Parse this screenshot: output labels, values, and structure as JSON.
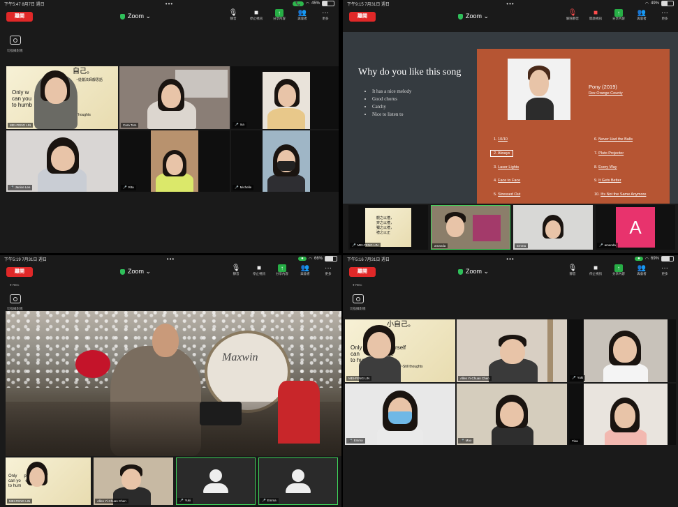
{
  "common": {
    "leave_label": "離開",
    "zoom_title": "Zoom ⌄",
    "more_dots": "•••",
    "camera_label": "切換攝影機",
    "rec_label": "● REC",
    "tool_labels": {
      "mute": "靜音",
      "stop_video": "停止視訊",
      "share": "分享內容",
      "participants": "與會者",
      "more": "更多"
    }
  },
  "q1": {
    "time": "下午5:47  8月7日 週日",
    "battery": "45%",
    "participant_count": "6",
    "slide_heading": "自己。",
    "slide_sub": "~從嚴法師靜思語",
    "slide_text": "Only w     pect yourself\ncan you      courage\nto humb",
    "slide_more": "Thoughts",
    "tiles": [
      "MEI-FENG LIN",
      "Cara Tom",
      "Ina",
      "Janice Lee",
      "Rita",
      "Michelle"
    ]
  },
  "q2": {
    "time": "下午9:15  7月31日 週日",
    "battery": "49%",
    "participant_count": "",
    "tool_labels": {
      "unmute": "解除靜音",
      "start_video": "開啟視訊",
      "share": "分享內容",
      "participants": "與會者",
      "more": "更多"
    },
    "slide_title": "Why do you like this song",
    "bullets": [
      "It has a nice melody",
      "Good chorus",
      "Catchy",
      "Nice to listen to"
    ],
    "album_title": "Pony (2019)",
    "album_artist": "Rex Orange County",
    "tracks_left": [
      [
        "1.",
        "10/10"
      ],
      [
        "2.",
        "Always"
      ],
      [
        "3.",
        "Laser Lights"
      ],
      [
        "4.",
        "Face to Face"
      ],
      [
        "5.",
        "Stressed Out"
      ]
    ],
    "tracks_right": [
      [
        "6.",
        "Never Had the Balls"
      ],
      [
        "7.",
        "Pluto Projector"
      ],
      [
        "8.",
        "Every Way"
      ],
      [
        "9.",
        "It Gets Better"
      ],
      [
        "10.",
        "It's Not the Same Anymore"
      ]
    ],
    "strip": [
      "MEI-FENG LIN",
      "amanda",
      "Emma",
      "amanda"
    ],
    "avatar_letter": "A",
    "strip_slide": "觀之以禮，\n齊之以禮，\n獨之以禮，\n禮之以正"
  },
  "q3": {
    "time": "下午5:19  7月31日 週日",
    "battery": "66%",
    "drum_text": "Maxwin",
    "strip": [
      "MEI-FENG LIN",
      "Allen Yi-Chuan Chen",
      "Yuki",
      "Emma"
    ],
    "strip_slide": "Only      pect yourself\ncan yo    e courage\nto hum"
  },
  "q4": {
    "time": "下午5:16  7月31日 週日",
    "battery": "69%",
    "participant_count": "5",
    "tiles": [
      "MEI-FENG LIN",
      "Allen Yi-Chuan Chen",
      "Yuki",
      "Emma",
      "Mao",
      "Tina"
    ],
    "slide_heading": "小自己。",
    "slide_text": "Only      spect yourself\ncan         courage\nto hum",
    "slide_more": "~Still thoughts"
  },
  "colors": {
    "leave": "#e02828",
    "share": "#27ae46",
    "active_speaker": "#3fd55a",
    "slide_bg": "#b65533",
    "avatar": "#e8336d"
  }
}
